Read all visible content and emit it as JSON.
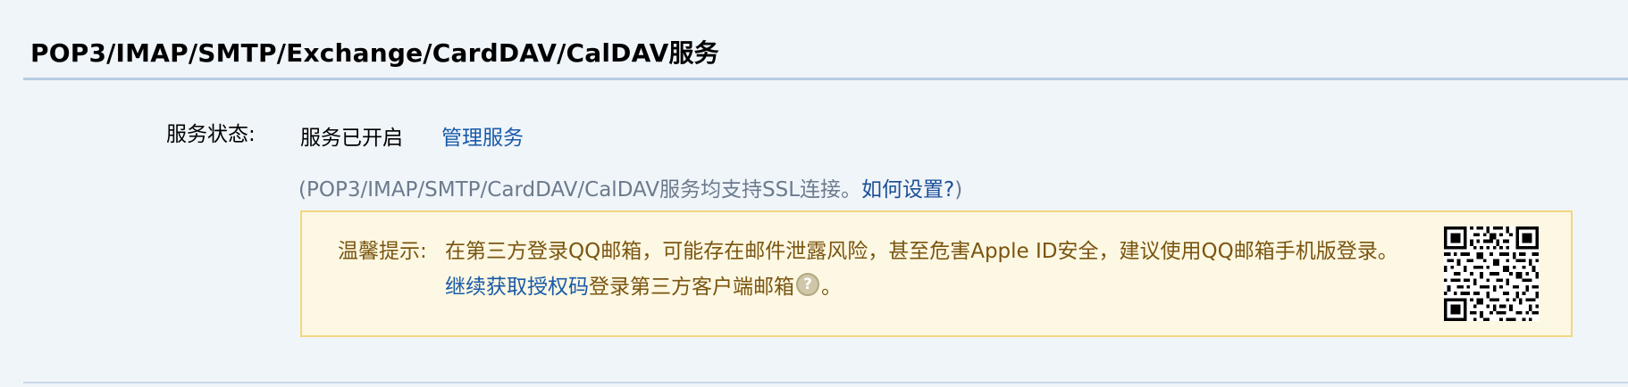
{
  "section": {
    "title": "POP3/IMAP/SMTP/Exchange/CardDAV/CalDAV服务"
  },
  "service": {
    "label": "服务状态:",
    "status": "服务已开启",
    "manage_link": "管理服务",
    "ssl_note_prefix": "(POP3/IMAP/SMTP/CardDAV/CalDAV服务均支持SSL连接。",
    "howto_link": "如何设置?",
    "ssl_note_suffix": ")"
  },
  "tip": {
    "label": "温馨提示:",
    "message": "在第三方登录QQ邮箱，可能存在邮件泄露风险，甚至危害Apple ID安全，建议使用QQ邮箱手机版登录。",
    "auth_link": "继续获取授权码",
    "line2_text": "登录第三方客户端邮箱",
    "help_icon": "question-circle-icon",
    "line2_end": "。",
    "qr_icon": "qr-code-icon"
  },
  "colors": {
    "background": "#f0f5fa",
    "link": "#1a5aa8",
    "tip_text": "#7a5510",
    "tip_background": "#fdf8e3",
    "tip_border": "#f2d680"
  }
}
